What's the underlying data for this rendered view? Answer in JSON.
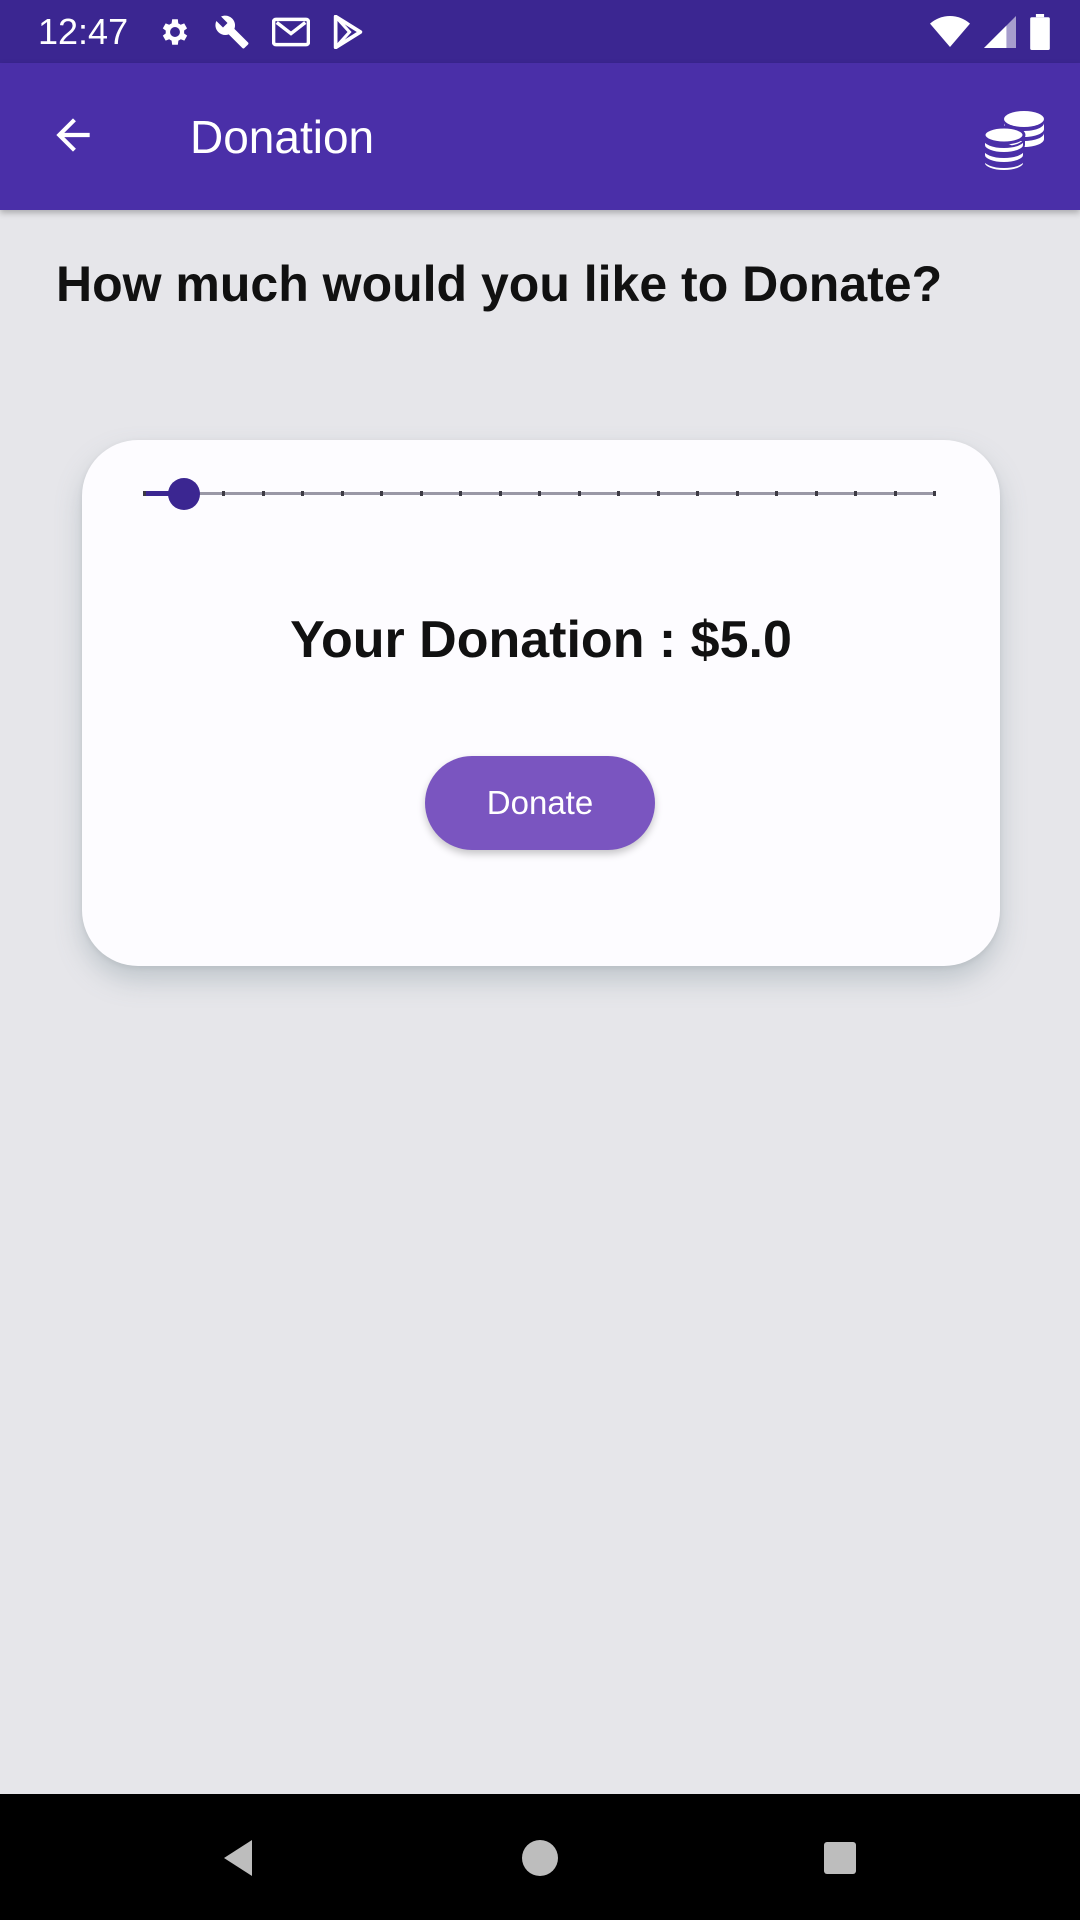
{
  "status_bar": {
    "time": "12:47",
    "left_icons": [
      "settings-icon",
      "wrench-icon",
      "gmail-icon",
      "play-store-icon"
    ],
    "right_icons": [
      "wifi-icon",
      "signal-icon",
      "battery-icon"
    ]
  },
  "app_bar": {
    "title": "Donation",
    "back_icon": "arrow-back-icon",
    "action_icon": "coins-icon",
    "color": "#4a2fa8"
  },
  "content": {
    "question": "How much would you like to Donate?"
  },
  "card": {
    "slider": {
      "value_fraction": 0.05,
      "tick_count": 20,
      "active_color": "#3b2691"
    },
    "donation_text": "Your Donation : $5.0",
    "donate_button": "Donate",
    "button_color": "#7a55c0"
  },
  "nav_bar": {
    "icons": [
      "nav-back-icon",
      "nav-home-icon",
      "nav-recents-icon"
    ]
  }
}
